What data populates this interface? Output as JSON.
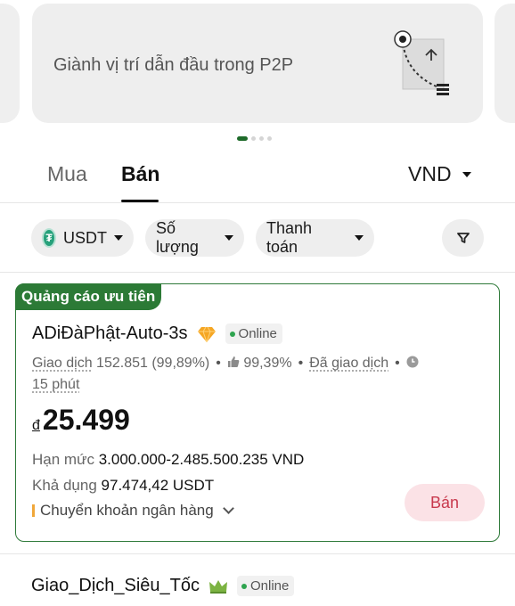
{
  "banner": {
    "text": "Giành vị trí dẫn đầu trong P2P",
    "slides": 4,
    "active_slide": 1
  },
  "tabs": {
    "buy": "Mua",
    "sell": "Bán",
    "active": "sell"
  },
  "currency": "VND",
  "filters": {
    "asset": "USDT",
    "asset_logo": "₮",
    "amount": "Số lượng",
    "payment": "Thanh toán",
    "filter_icon": "funnel-icon"
  },
  "ad": {
    "badge": "Quảng cáo ưu tiên",
    "merchant": "ADiĐàPhật-Auto-3s",
    "merchant_badge_icon": "diamond-icon",
    "status": "Online",
    "trades_label": "Giao dịch",
    "trades_value": "152.851 (99,89%)",
    "like_rate": "99,39%",
    "completed_label": "Đã giao dịch",
    "time": "15 phút",
    "currency_symbol": "đ",
    "price": "25.499",
    "limit_label": "Hạn mức",
    "limit_value": "3.000.000-2.485.500.235 VND",
    "available_label": "Khả dụng",
    "available_value": "97.474,42 USDT",
    "payment_method": "Chuyển khoản ngân hàng",
    "action": "Bán",
    "colors": {
      "border": "#2f7a3a",
      "badge_bg": "#2c7a36",
      "action_bg": "#fbe2e6",
      "action_text": "#c8394d"
    }
  },
  "ad2": {
    "merchant": "Giao_Dịch_Siêu_Tốc",
    "merchant_badge_icon": "crown-icon",
    "status": "Online"
  }
}
